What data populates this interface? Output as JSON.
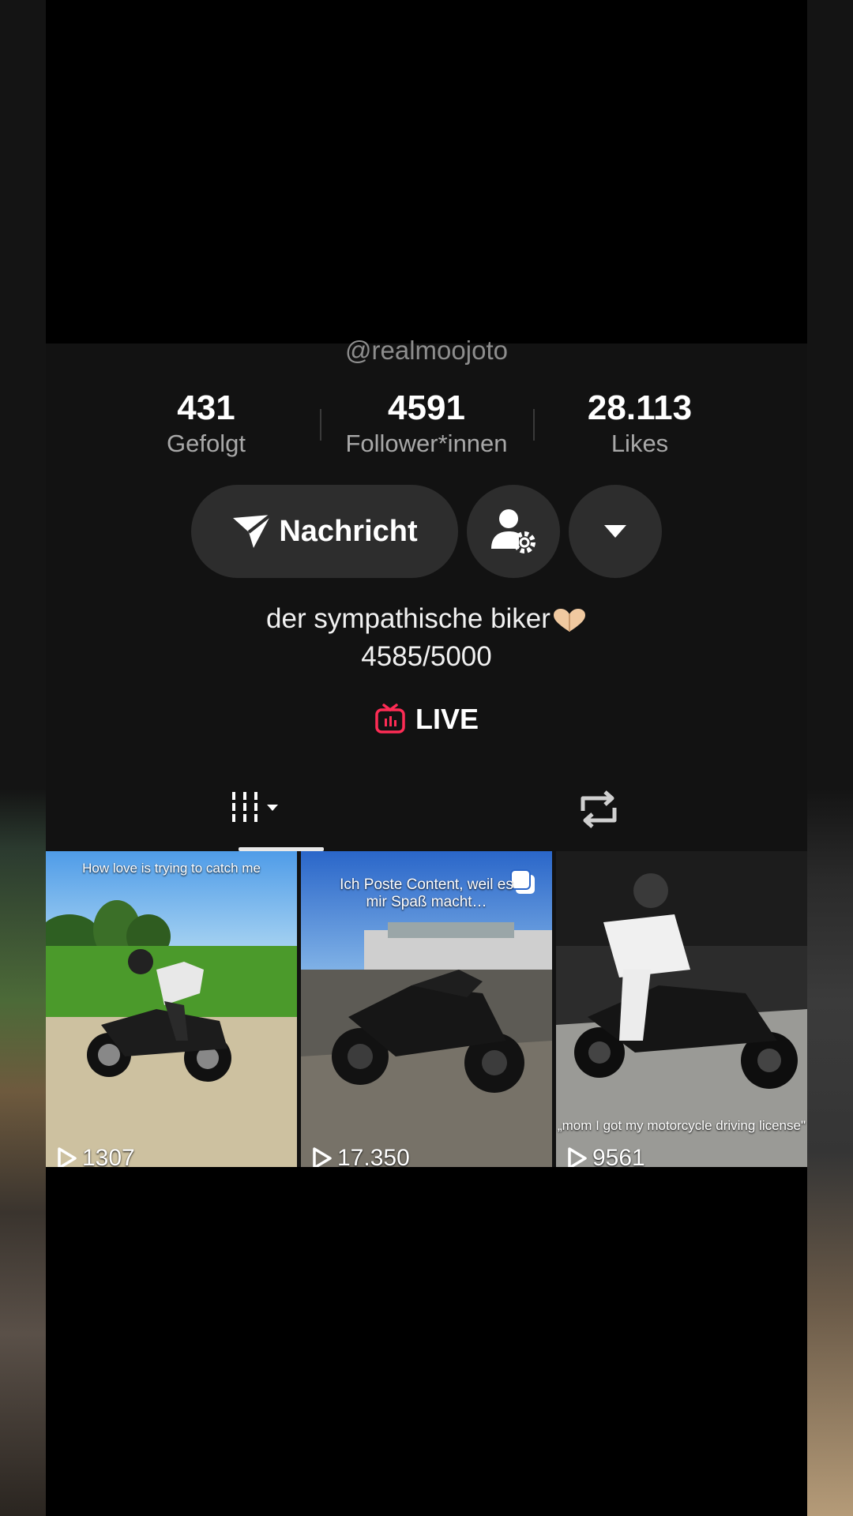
{
  "profile": {
    "handle": "@realmoojoto"
  },
  "stats": [
    {
      "value": "431",
      "label": "Gefolgt"
    },
    {
      "value": "4591",
      "label": "Follower*innen"
    },
    {
      "value": "28.113",
      "label": "Likes"
    }
  ],
  "actions": {
    "message_label": "Nachricht",
    "friend_icon": "person-gear-icon",
    "more_icon": "caret-down-icon"
  },
  "bio": {
    "line1": "der sympathische biker",
    "line2": "4585/5000"
  },
  "live": {
    "label": "LIVE",
    "accent": "#fe2c55"
  },
  "tabs": [
    {
      "icon": "video-grid-icon",
      "active": true
    },
    {
      "icon": "repost-icon",
      "active": false
    }
  ],
  "videos": [
    {
      "caption": "How love is trying to catch me",
      "views": "1307"
    },
    {
      "caption": "Ich Poste Content, weil es mir Spaß macht…",
      "views": "17.350"
    },
    {
      "caption": "„mom I got my motorcycle driving license\"",
      "views": "9561"
    }
  ]
}
